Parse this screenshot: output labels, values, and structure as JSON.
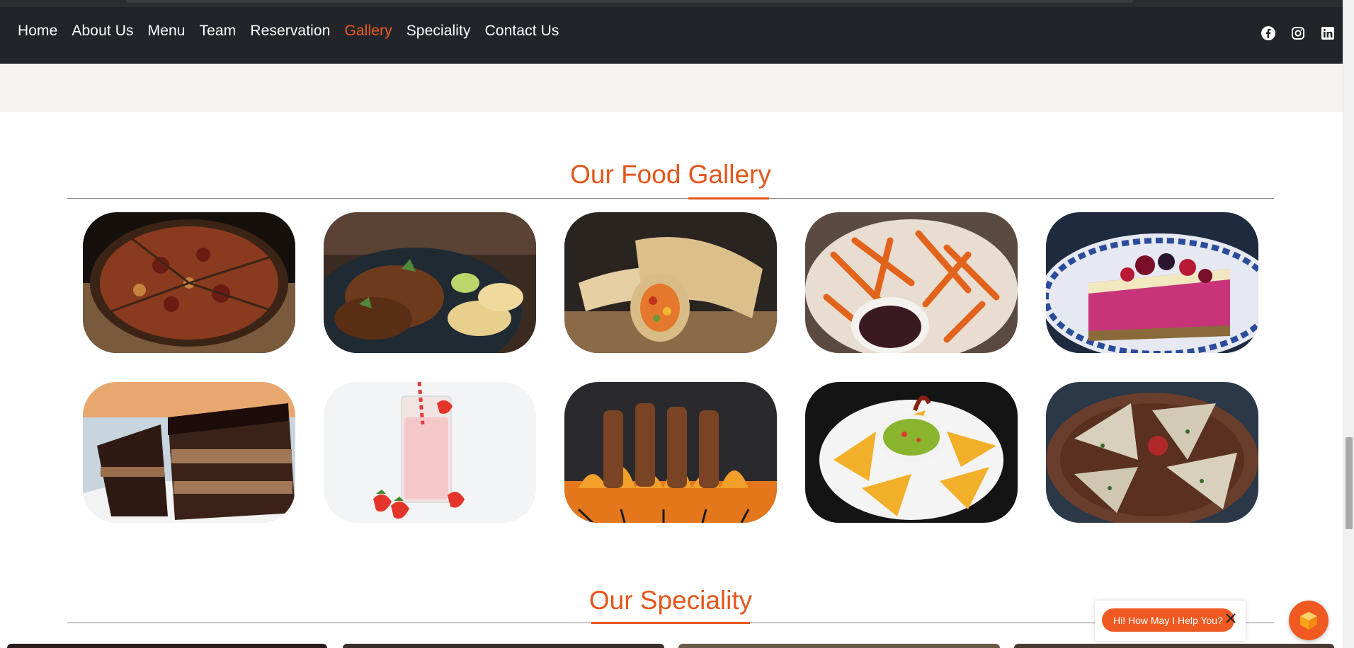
{
  "nav": {
    "items": [
      {
        "label": "Home",
        "active": false
      },
      {
        "label": "About Us",
        "active": false
      },
      {
        "label": "Menu",
        "active": false
      },
      {
        "label": "Team",
        "active": false
      },
      {
        "label": "Reservation",
        "active": false
      },
      {
        "label": "Gallery",
        "active": true
      },
      {
        "label": "Speciality",
        "active": false
      },
      {
        "label": "Contact Us",
        "active": false
      }
    ],
    "socials": [
      "facebook-icon",
      "instagram-icon",
      "linkedin-icon"
    ]
  },
  "gallery": {
    "title": "Our Food Gallery",
    "items": [
      {
        "name": "pizza-image"
      },
      {
        "name": "grilled-chicken-chips-image"
      },
      {
        "name": "wrap-image"
      },
      {
        "name": "sweet-potato-fries-image"
      },
      {
        "name": "berry-cheesecake-image"
      },
      {
        "name": "chocolate-cake-image"
      },
      {
        "name": "strawberry-smoothie-image"
      },
      {
        "name": "grilled-skewers-image"
      },
      {
        "name": "nachos-guacamole-image"
      },
      {
        "name": "quesadilla-image"
      }
    ]
  },
  "speciality": {
    "title": "Our Speciality"
  },
  "chat": {
    "prompt": "Hi! How May I Help You?"
  },
  "colors": {
    "accent": "#e4561c",
    "navbar": "#212529",
    "band": "#f5f3ef"
  }
}
